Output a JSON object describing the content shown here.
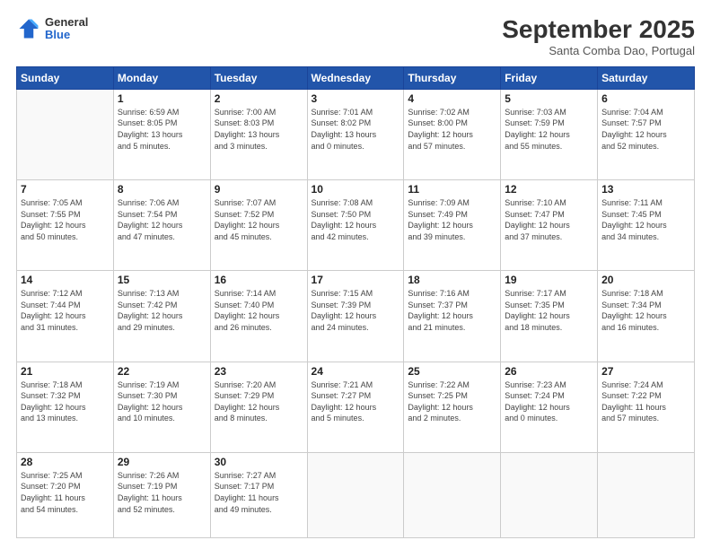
{
  "header": {
    "logo": {
      "line1": "General",
      "line2": "Blue"
    },
    "title": "September 2025",
    "subtitle": "Santa Comba Dao, Portugal"
  },
  "weekdays": [
    "Sunday",
    "Monday",
    "Tuesday",
    "Wednesday",
    "Thursday",
    "Friday",
    "Saturday"
  ],
  "weeks": [
    [
      {
        "day": "",
        "info": ""
      },
      {
        "day": "1",
        "info": "Sunrise: 6:59 AM\nSunset: 8:05 PM\nDaylight: 13 hours\nand 5 minutes."
      },
      {
        "day": "2",
        "info": "Sunrise: 7:00 AM\nSunset: 8:03 PM\nDaylight: 13 hours\nand 3 minutes."
      },
      {
        "day": "3",
        "info": "Sunrise: 7:01 AM\nSunset: 8:02 PM\nDaylight: 13 hours\nand 0 minutes."
      },
      {
        "day": "4",
        "info": "Sunrise: 7:02 AM\nSunset: 8:00 PM\nDaylight: 12 hours\nand 57 minutes."
      },
      {
        "day": "5",
        "info": "Sunrise: 7:03 AM\nSunset: 7:59 PM\nDaylight: 12 hours\nand 55 minutes."
      },
      {
        "day": "6",
        "info": "Sunrise: 7:04 AM\nSunset: 7:57 PM\nDaylight: 12 hours\nand 52 minutes."
      }
    ],
    [
      {
        "day": "7",
        "info": "Sunrise: 7:05 AM\nSunset: 7:55 PM\nDaylight: 12 hours\nand 50 minutes."
      },
      {
        "day": "8",
        "info": "Sunrise: 7:06 AM\nSunset: 7:54 PM\nDaylight: 12 hours\nand 47 minutes."
      },
      {
        "day": "9",
        "info": "Sunrise: 7:07 AM\nSunset: 7:52 PM\nDaylight: 12 hours\nand 45 minutes."
      },
      {
        "day": "10",
        "info": "Sunrise: 7:08 AM\nSunset: 7:50 PM\nDaylight: 12 hours\nand 42 minutes."
      },
      {
        "day": "11",
        "info": "Sunrise: 7:09 AM\nSunset: 7:49 PM\nDaylight: 12 hours\nand 39 minutes."
      },
      {
        "day": "12",
        "info": "Sunrise: 7:10 AM\nSunset: 7:47 PM\nDaylight: 12 hours\nand 37 minutes."
      },
      {
        "day": "13",
        "info": "Sunrise: 7:11 AM\nSunset: 7:45 PM\nDaylight: 12 hours\nand 34 minutes."
      }
    ],
    [
      {
        "day": "14",
        "info": "Sunrise: 7:12 AM\nSunset: 7:44 PM\nDaylight: 12 hours\nand 31 minutes."
      },
      {
        "day": "15",
        "info": "Sunrise: 7:13 AM\nSunset: 7:42 PM\nDaylight: 12 hours\nand 29 minutes."
      },
      {
        "day": "16",
        "info": "Sunrise: 7:14 AM\nSunset: 7:40 PM\nDaylight: 12 hours\nand 26 minutes."
      },
      {
        "day": "17",
        "info": "Sunrise: 7:15 AM\nSunset: 7:39 PM\nDaylight: 12 hours\nand 24 minutes."
      },
      {
        "day": "18",
        "info": "Sunrise: 7:16 AM\nSunset: 7:37 PM\nDaylight: 12 hours\nand 21 minutes."
      },
      {
        "day": "19",
        "info": "Sunrise: 7:17 AM\nSunset: 7:35 PM\nDaylight: 12 hours\nand 18 minutes."
      },
      {
        "day": "20",
        "info": "Sunrise: 7:18 AM\nSunset: 7:34 PM\nDaylight: 12 hours\nand 16 minutes."
      }
    ],
    [
      {
        "day": "21",
        "info": "Sunrise: 7:18 AM\nSunset: 7:32 PM\nDaylight: 12 hours\nand 13 minutes."
      },
      {
        "day": "22",
        "info": "Sunrise: 7:19 AM\nSunset: 7:30 PM\nDaylight: 12 hours\nand 10 minutes."
      },
      {
        "day": "23",
        "info": "Sunrise: 7:20 AM\nSunset: 7:29 PM\nDaylight: 12 hours\nand 8 minutes."
      },
      {
        "day": "24",
        "info": "Sunrise: 7:21 AM\nSunset: 7:27 PM\nDaylight: 12 hours\nand 5 minutes."
      },
      {
        "day": "25",
        "info": "Sunrise: 7:22 AM\nSunset: 7:25 PM\nDaylight: 12 hours\nand 2 minutes."
      },
      {
        "day": "26",
        "info": "Sunrise: 7:23 AM\nSunset: 7:24 PM\nDaylight: 12 hours\nand 0 minutes."
      },
      {
        "day": "27",
        "info": "Sunrise: 7:24 AM\nSunset: 7:22 PM\nDaylight: 11 hours\nand 57 minutes."
      }
    ],
    [
      {
        "day": "28",
        "info": "Sunrise: 7:25 AM\nSunset: 7:20 PM\nDaylight: 11 hours\nand 54 minutes."
      },
      {
        "day": "29",
        "info": "Sunrise: 7:26 AM\nSunset: 7:19 PM\nDaylight: 11 hours\nand 52 minutes."
      },
      {
        "day": "30",
        "info": "Sunrise: 7:27 AM\nSunset: 7:17 PM\nDaylight: 11 hours\nand 49 minutes."
      },
      {
        "day": "",
        "info": ""
      },
      {
        "day": "",
        "info": ""
      },
      {
        "day": "",
        "info": ""
      },
      {
        "day": "",
        "info": ""
      }
    ]
  ]
}
